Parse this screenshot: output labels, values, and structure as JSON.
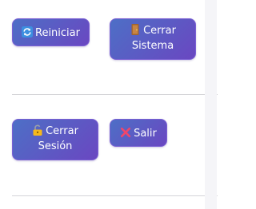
{
  "buttons": {
    "restart": {
      "label": "Reiniciar",
      "icon": "restart-icon"
    },
    "shutdown_system": {
      "label_line1": "Cerrar",
      "label_line2": "Sistema",
      "icon": "door-icon"
    },
    "logout_session": {
      "label_line1": "Cerrar",
      "label_line2": "Sesión",
      "icon": "unlocked-padlock-icon"
    },
    "exit": {
      "label": "Salir",
      "icon": "cross-mark-icon"
    }
  },
  "colors": {
    "button_gradient_start": "#4d6fc6",
    "button_gradient_end": "#6a47c1",
    "button_text": "#ffffff",
    "divider": "#d4d4d8"
  }
}
